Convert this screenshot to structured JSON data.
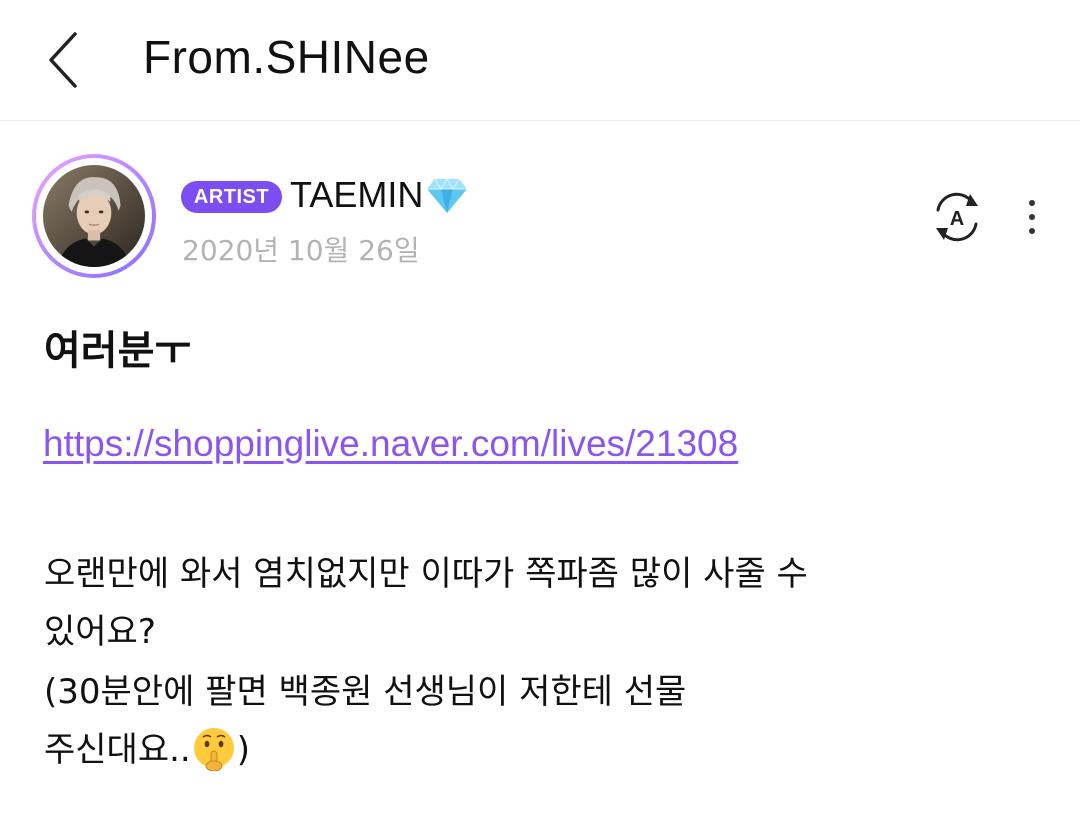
{
  "header": {
    "title": "From.SHINee",
    "back_icon": "chevron-left-icon"
  },
  "post": {
    "badge": "ARTIST",
    "author": "TAEMIN",
    "author_icon": "diamond-icon",
    "date": "2020년 10월 26일",
    "title": "여러분ㅜ",
    "link": "https://shoppinglive.naver.com/lives/21308",
    "body_lines": [
      "오랜만에 와서 염치없지만 이따가 쪽파좀 많이 사줄 수",
      "있어요?",
      "(30분안에 팔면 백종원 선생님이 저한테 선물",
      "주신대요.."
    ],
    "body_trailing": ")",
    "emoji": "shushing-face-icon"
  },
  "actions": {
    "translate_icon": "translate-icon",
    "more_icon": "more-vertical-icon"
  },
  "colors": {
    "accent": "#7c4df0",
    "link": "#8b55f0",
    "date_gray": "#b3b3b3",
    "gem": "#5ec8f2"
  }
}
